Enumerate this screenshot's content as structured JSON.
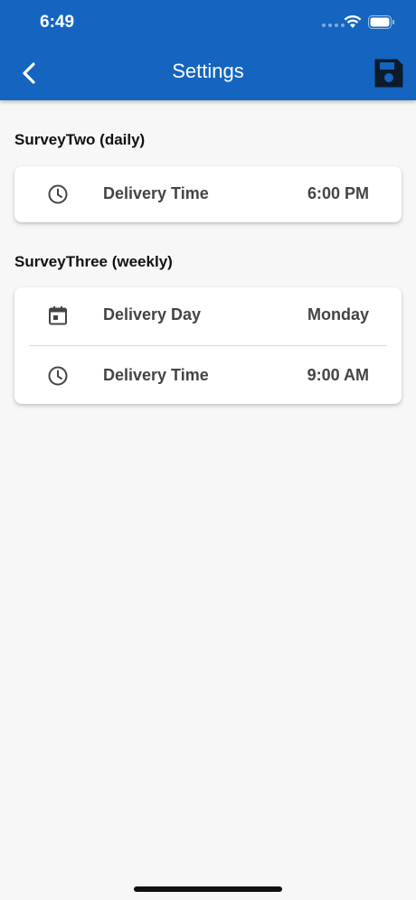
{
  "status_bar": {
    "time": "6:49"
  },
  "nav": {
    "title": "Settings",
    "back_icon": "chevron-left-icon",
    "save_icon": "save-icon"
  },
  "colors": {
    "header": "#1565c0",
    "background": "#f7f7f7",
    "card": "#ffffff",
    "text": "#444444"
  },
  "sections": [
    {
      "title": "SurveyTwo (daily)",
      "rows": [
        {
          "icon": "clock-icon",
          "label": "Delivery Time",
          "value": "6:00 PM"
        }
      ]
    },
    {
      "title": "SurveyThree (weekly)",
      "rows": [
        {
          "icon": "calendar-icon",
          "label": "Delivery Day",
          "value": "Monday"
        },
        {
          "icon": "clock-icon",
          "label": "Delivery Time",
          "value": "9:00 AM"
        }
      ]
    }
  ]
}
